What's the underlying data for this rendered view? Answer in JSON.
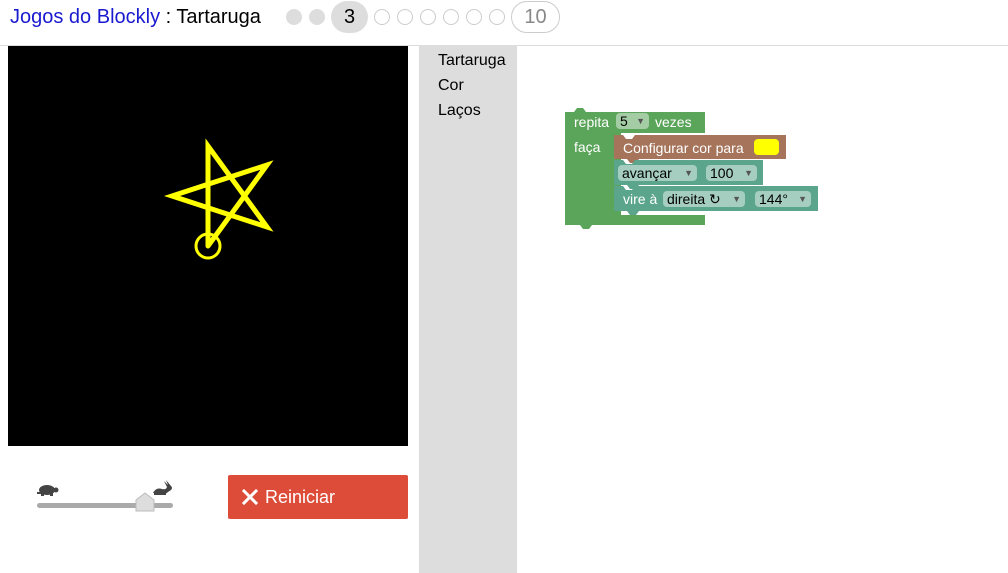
{
  "header": {
    "app_link": "Jogos do Blockly",
    "separator": ":",
    "game_title": "Tartaruga",
    "levels": {
      "current_label": "3",
      "last_label": "10"
    }
  },
  "controls": {
    "reset_label": "Reiniciar",
    "speed_level": 0.79
  },
  "toolbox": {
    "categories": [
      "Tartaruga",
      "Cor",
      "Laços"
    ]
  },
  "blocks": {
    "repeat": {
      "label": "repita",
      "count": "5",
      "suffix": "vezes",
      "do_label": "faça"
    },
    "set_color": {
      "label": "Configurar cor para",
      "color": "#ffff00"
    },
    "move": {
      "direction": "avançar",
      "distance": "100"
    },
    "turn": {
      "label": "vire à",
      "direction": "direita ↻",
      "angle": "144°"
    }
  },
  "colors": {
    "loop_block": "#5ba55b",
    "colour_block": "#a5745b",
    "turtle_block": "#5ba58c",
    "reset_button": "#dd4b39",
    "link": "#1a1ad0",
    "drawing": "#ffff00"
  }
}
